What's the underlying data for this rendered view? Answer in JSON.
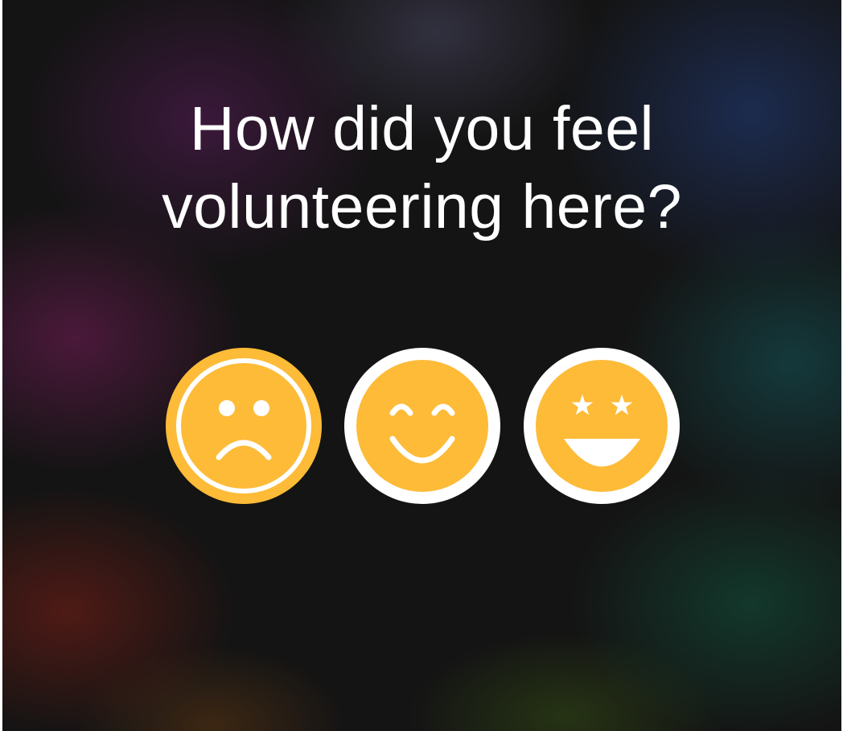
{
  "prompt": {
    "question": "How did you feel\nvolunteering here?"
  },
  "ratings": [
    {
      "icon": "sad-face-icon",
      "selected": true
    },
    {
      "icon": "smiling-face-icon",
      "selected": false
    },
    {
      "icon": "star-struck-face-icon",
      "selected": false
    }
  ],
  "colors": {
    "face_fill": "#fdbb38",
    "ring_default": "#ffffff",
    "ring_selected": "#fdbb38",
    "text": "#ffffff"
  }
}
